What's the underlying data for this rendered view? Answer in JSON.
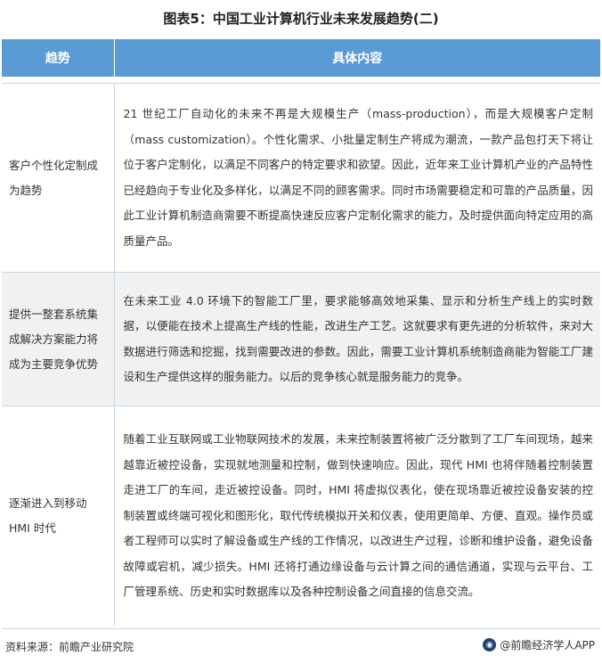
{
  "title": "图表5：中国工业计算机行业未来发展趋势(二)",
  "table": {
    "headers": [
      "趋势",
      "具体内容"
    ],
    "rows": [
      {
        "trend": "客户个性化定制成为趋势",
        "content": "21 世纪工厂自动化的未来不再是大规模生产（mass-production），而是大规模客户定制（mass customization）。个性化需求、小批量定制生产将成为潮流，一款产品包打天下将让位于客户定制化，以满足不同客户的特定要求和欲望。因此，近年来工业计算机产业的产品特性已经趋向于专业化及多样化，以满足不同的顾客需求。同时市场需要稳定和可靠的产品质量，因此工业计算机制造商需要不断提高快速反应客户定制化需求的能力，及时提供面向特定应用的高质量产品。"
      },
      {
        "trend": "提供一整套系统集成解决方案能力将成为主要竞争优势",
        "content": "在未来工业 4.0 环境下的智能工厂里，要求能够高效地采集、显示和分析生产线上的实时数据，以便能在技术上提高生产线的性能，改进生产工艺。这就要求有更先进的分析软件，来对大数据进行筛选和挖掘，找到需要改进的参数。因此，需要工业计算机系统制造商能为智能工厂建设和生产提供这样的服务能力。以后的竞争核心就是服务能力的竞争。"
      },
      {
        "trend": "逐渐进入到移动 HMI 时代",
        "content": "随着工业互联网或工业物联网技术的发展，未来控制装置将被广泛分散到了工厂车间现场，越来越靠近被控设备，实现就地测量和控制，做到快速响应。因此，现代 HMI 也将伴随着控制装置走进工厂的车间，走近被控设备。同时，HMI 将虚拟仪表化，使在现场靠近被控设备安装的控制装置或终端可视化和图形化，取代传统模拟开关和仪表，使用更简单、方便、直观。操作员或者工程师可以实时了解设备或生产线的工作情况，以改进生产过程，诊断和维护设备，避免设备故障或宕机，减少损失。HMI 还将打通边缘设备与云计算之间的通信通道，实现与云平台、工厂管理系统、历史和实时数据库以及各种控制设备之间直接的信息交流。"
      }
    ]
  },
  "footer": {
    "source": "资料来源：前瞻产业研究院",
    "brand": "@前瞻经济学人APP"
  }
}
